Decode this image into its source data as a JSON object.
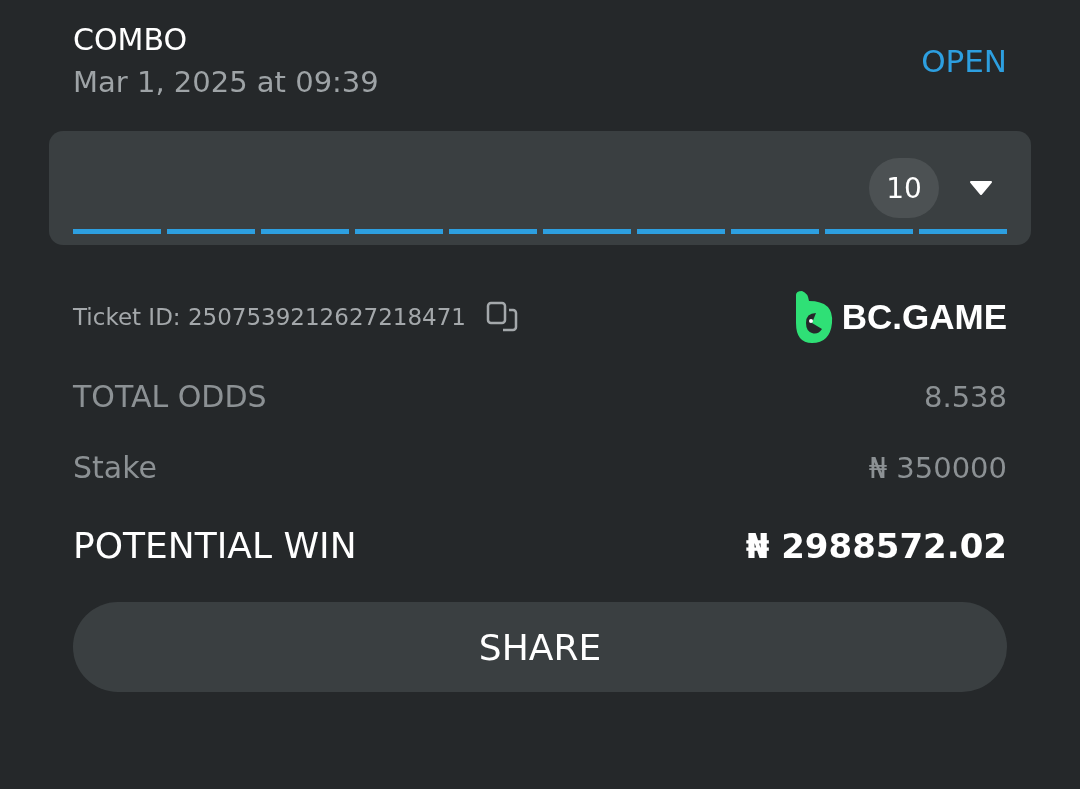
{
  "header": {
    "title": "COMBO",
    "date": "Mar 1, 2025 at 09:39",
    "status": "OPEN"
  },
  "legs": {
    "count": "10",
    "expanded": false,
    "segments": [
      {
        "settled": true
      },
      {
        "settled": true
      },
      {
        "settled": true
      },
      {
        "settled": true
      },
      {
        "settled": true
      },
      {
        "settled": true
      },
      {
        "settled": true
      },
      {
        "settled": true
      },
      {
        "settled": true
      },
      {
        "settled": true
      }
    ]
  },
  "ticket": {
    "label": "Ticket ID: 2507539212627218471",
    "brand": "BC.GAME"
  },
  "summary": [
    {
      "kind": "odds",
      "label": "TOTAL ODDS",
      "value": "8.538"
    },
    {
      "kind": "stake",
      "label": "Stake",
      "value": "₦ 350000"
    },
    {
      "kind": "win",
      "label": "POTENTIAL WIN",
      "value": "₦ 2988572.02"
    }
  ],
  "share_button": "SHARE"
}
